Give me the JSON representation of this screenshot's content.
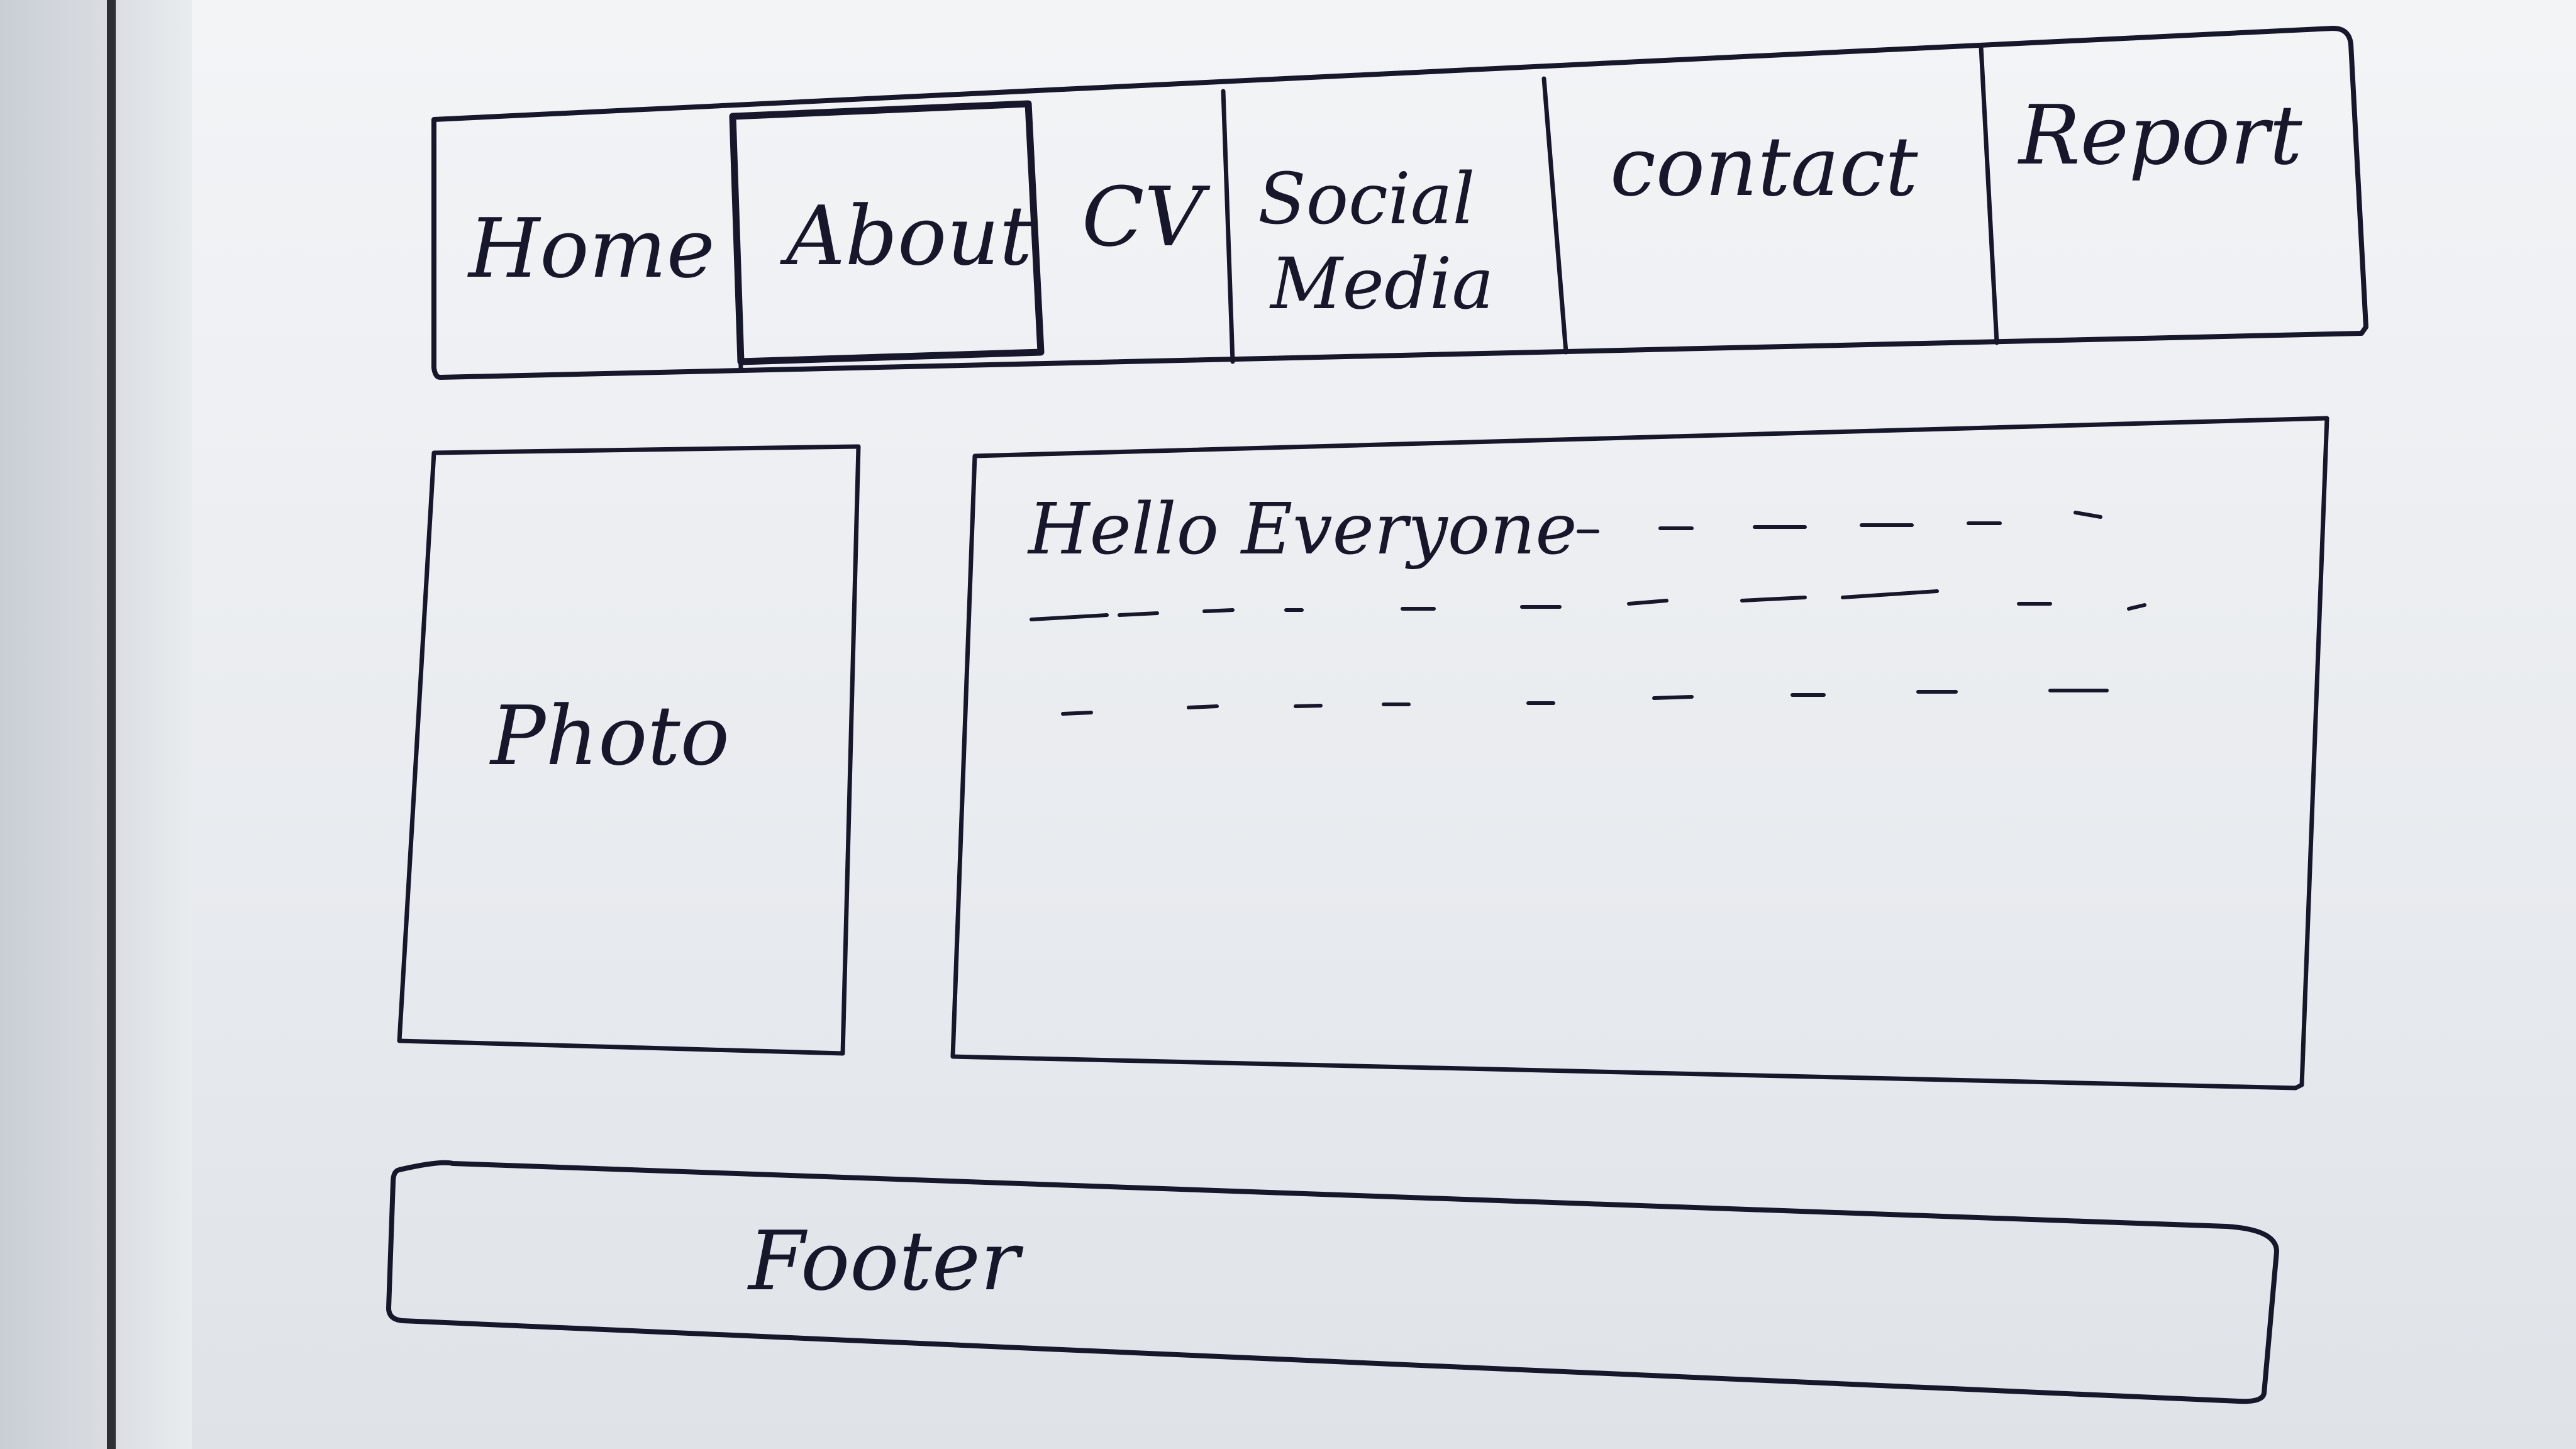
{
  "nav": {
    "items": [
      {
        "label": "Home"
      },
      {
        "label": "About"
      },
      {
        "label": "CV"
      },
      {
        "label": "Social",
        "label2": "Media"
      },
      {
        "label": "contact"
      },
      {
        "label": "Report"
      }
    ]
  },
  "photo": {
    "label": "Photo"
  },
  "content": {
    "heading": "Hello Everyone"
  },
  "footer": {
    "label": "Footer"
  }
}
